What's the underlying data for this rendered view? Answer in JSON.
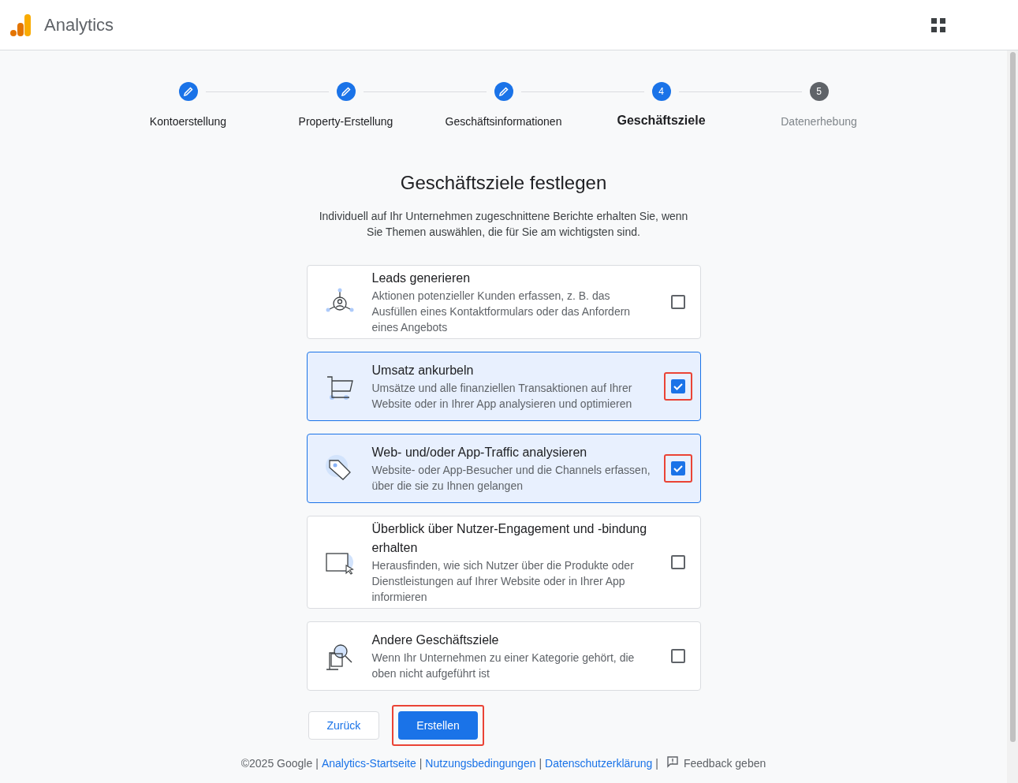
{
  "header": {
    "title": "Analytics"
  },
  "steps": [
    {
      "label": "Kontoerstellung",
      "kind": "done"
    },
    {
      "label": "Property-Erstellung",
      "kind": "done"
    },
    {
      "label": "Geschäftsinformationen",
      "kind": "done"
    },
    {
      "label": "Geschäftsziele",
      "kind": "current",
      "number": "4"
    },
    {
      "label": "Datenerhebung",
      "kind": "pending",
      "number": "5"
    }
  ],
  "heading": "Geschäftsziele festlegen",
  "intro": "Individuell auf Ihr Unternehmen zugeschnittene Berichte erhalten Sie, wenn Sie Themen auswählen, die für Sie am wichtigsten sind.",
  "goals": [
    {
      "kind": "leads",
      "title": "Leads generieren",
      "description": "Aktionen potenzieller Kunden erfassen, z. B. das Ausfüllen eines Kontaktformulars oder das Anfordern eines Angebots",
      "checked": false,
      "highlighted": false
    },
    {
      "kind": "sales",
      "title": "Umsatz ankurbeln",
      "description": "Umsätze und alle finanziellen Transaktionen auf Ihrer Website oder in Ihrer App analysieren und optimieren",
      "checked": true,
      "highlighted": true
    },
    {
      "kind": "traffic",
      "title": "Web- und/oder App-Traffic analysieren",
      "description": "Website- oder App-Besucher und die Channels erfassen, über die sie zu Ihnen gelangen",
      "checked": true,
      "highlighted": true
    },
    {
      "kind": "engagement",
      "title": "Überblick über Nutzer-Engagement und -bindung erhalten",
      "description": "Herausfinden, wie sich Nutzer über die Produkte oder Dienstleistungen auf Ihrer Website oder in Ihrer App informieren",
      "checked": false,
      "highlighted": false
    },
    {
      "kind": "other",
      "title": "Andere Geschäftsziele",
      "description": "Wenn Ihr Unternehmen zu einer Kategorie gehört, die oben nicht aufgeführt ist",
      "checked": false,
      "highlighted": false
    }
  ],
  "buttons": [
    {
      "kind": "secondary",
      "label": "Zurück",
      "highlighted": false
    },
    {
      "kind": "primary",
      "label": "Erstellen",
      "highlighted": true
    }
  ],
  "footer": [
    {
      "kind": "text",
      "text": "©2025 Google"
    },
    {
      "kind": "sep",
      "text": "|"
    },
    {
      "kind": "link",
      "text": "Analytics-Startseite"
    },
    {
      "kind": "sep",
      "text": "|"
    },
    {
      "kind": "link",
      "text": "Nutzungsbedingungen"
    },
    {
      "kind": "sep",
      "text": "|"
    },
    {
      "kind": "link",
      "text": "Datenschutzerklärung"
    },
    {
      "kind": "sep",
      "text": "|"
    },
    {
      "kind": "feedback",
      "text": "Feedback geben"
    }
  ]
}
